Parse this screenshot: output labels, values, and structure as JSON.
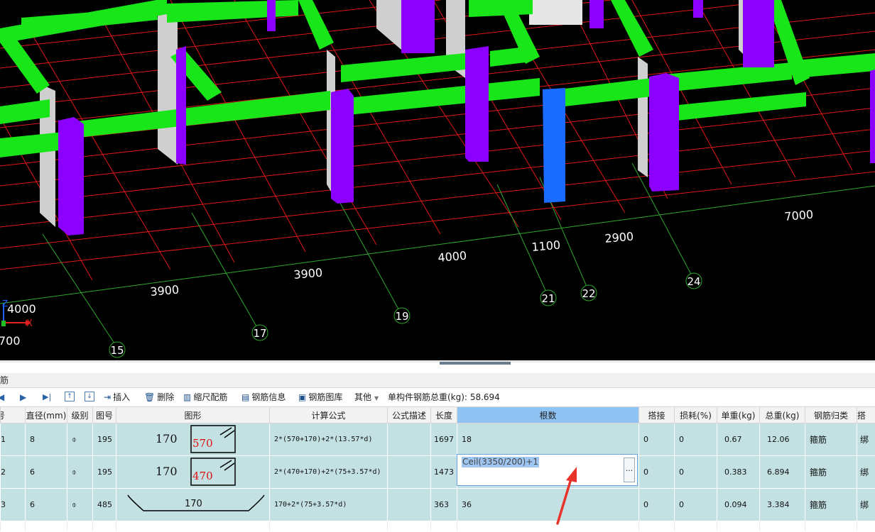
{
  "viewport": {
    "axis_labels": [
      "15",
      "17",
      "19",
      "21",
      "22",
      "24"
    ],
    "dimensions": [
      "4000",
      "3900",
      "3900",
      "4000",
      "1100",
      "2900",
      "7000",
      "700"
    ],
    "axis_x_label": "X",
    "axis_z_label": "Z",
    "colors": {
      "background": "#000000",
      "grid": "#e11818",
      "axis": "#2ea82e",
      "beam": "#19e619",
      "column": "#8b00ff",
      "selected_column": "#1a6bff",
      "wall": "#cfcfcf"
    }
  },
  "panel": {
    "title": "钢筋"
  },
  "toolbar": {
    "nav_first": "◀",
    "nav_next": "▶",
    "nav_last": "▶|",
    "nav_up": "↑",
    "nav_down": "↓",
    "insert": "插入",
    "delete": "删除",
    "scale_rebar": "缩尺配筋",
    "rebar_info": "钢筋信息",
    "rebar_library": "钢筋图库",
    "other": "其他",
    "total_weight_label": "单构件钢筋总重(kg):",
    "total_weight_value": "58.694"
  },
  "table": {
    "columns": [
      "号",
      "直径(mm)",
      "级别",
      "图号",
      "图形",
      "计算公式",
      "公式描述",
      "长度",
      "根数",
      "搭接",
      "损耗(%)",
      "单重(kg)",
      "总重(kg)",
      "钢筋归类",
      "搭"
    ],
    "rows": [
      {
        "no": "1",
        "dia": "8",
        "grade": "⌽",
        "fig": "195",
        "shape_a": "170",
        "shape_b": "570",
        "formula": "2*(570+170)+2*(13.57*d)",
        "desc": "",
        "length": "1697",
        "count": "18",
        "lap": "0",
        "loss": "0",
        "unit_w": "0.67",
        "total_w": "12.06",
        "category": "箍筋",
        "lap_type": "绑"
      },
      {
        "no": "2",
        "dia": "6",
        "grade": "⌽",
        "fig": "195",
        "shape_a": "170",
        "shape_b": "470",
        "formula": "2*(470+170)+2*(75+3.57*d)",
        "desc": "",
        "length": "1473",
        "count": "Ceil(3350/200)+1",
        "lap": "0",
        "loss": "0",
        "unit_w": "0.383",
        "total_w": "6.894",
        "category": "箍筋",
        "lap_type": "绑"
      },
      {
        "no": "3",
        "dia": "6",
        "grade": "⌽",
        "fig": "485",
        "shape_a": "170",
        "shape_b": "",
        "formula": "170+2*(75+3.57*d)",
        "desc": "",
        "length": "363",
        "count": "36",
        "lap": "0",
        "loss": "0",
        "unit_w": "0.094",
        "total_w": "3.384",
        "category": "箍筋",
        "lap_type": "绑"
      }
    ]
  },
  "editor": {
    "value": "Ceil(3350/200)+1",
    "button": "..."
  }
}
